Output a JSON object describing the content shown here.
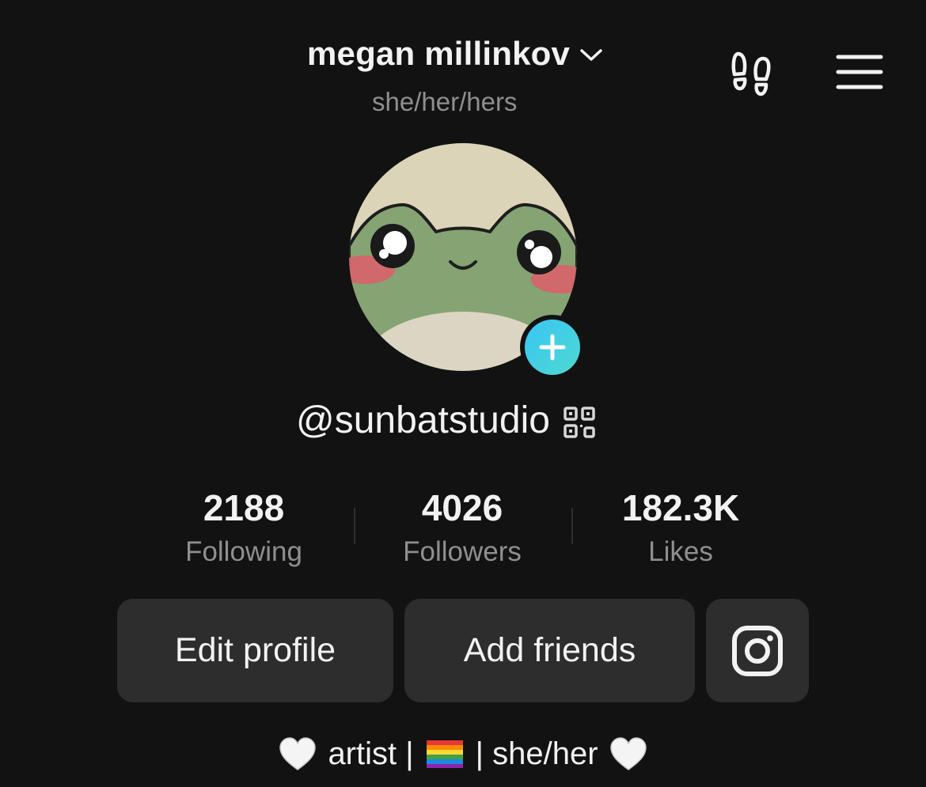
{
  "header": {
    "display_name": "megan millinkov",
    "pronouns": "she/her/hers",
    "icons": {
      "account_switch": "chevron-down-icon",
      "profile_views": "footprints-icon",
      "menu": "hamburger-menu-icon"
    }
  },
  "profile": {
    "avatar": "frog-avatar",
    "add_avatar_icon": "plus-icon",
    "handle": "@sunbatstudio",
    "qr_icon": "qr-code-icon"
  },
  "stats": [
    {
      "value": "2188",
      "label": "Following"
    },
    {
      "value": "4026",
      "label": "Followers"
    },
    {
      "value": "182.3K",
      "label": "Likes"
    }
  ],
  "actions": {
    "edit_profile": "Edit profile",
    "add_friends": "Add friends",
    "instagram_icon": "instagram-icon"
  },
  "bio": {
    "text_parts": [
      "artist |",
      "| she/her"
    ],
    "emoji": [
      "white-heart-icon",
      "rainbow-flag-icon",
      "white-heart-icon"
    ]
  },
  "colors": {
    "background": "#121212",
    "button_bg": "#2d2d2d",
    "secondary_text": "#8f8f8f",
    "plus_badge": "#38c6f4"
  }
}
